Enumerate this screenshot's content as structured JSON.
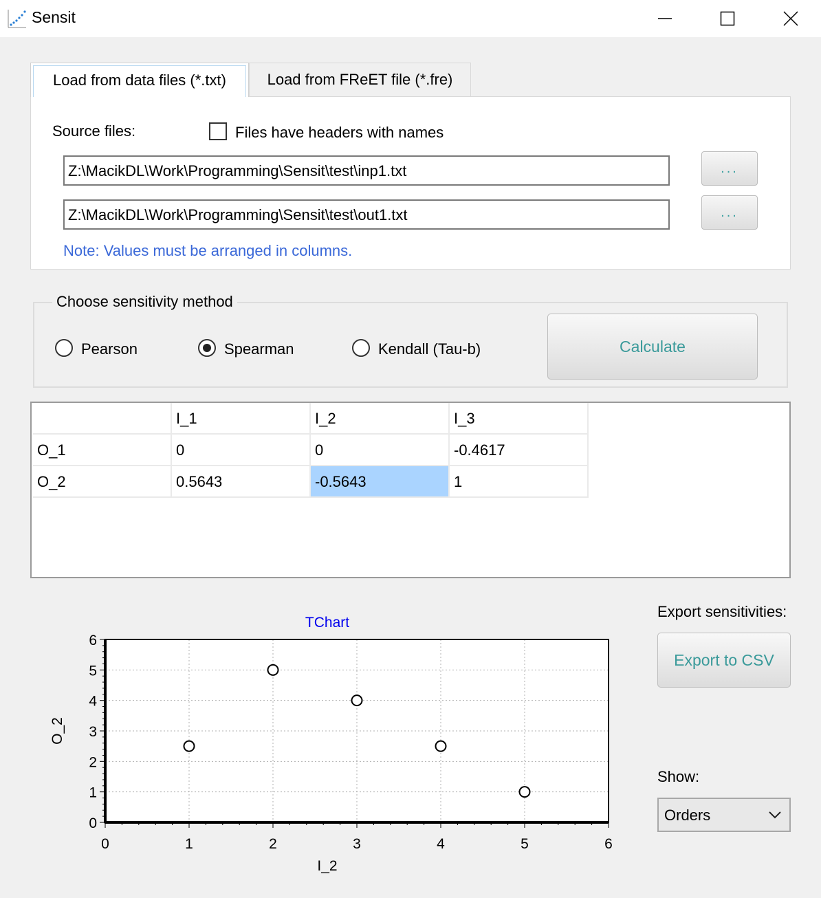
{
  "window": {
    "title": "Sensit"
  },
  "tabs": [
    {
      "label": "Load from data files (*.txt)",
      "active": true
    },
    {
      "label": "Load from FReET file (*.fre)",
      "active": false
    }
  ],
  "source": {
    "label": "Source files:",
    "headers_checkbox_label": "Files have headers with names",
    "headers_checked": false,
    "input_file": "Z:\\MacikDL\\Work\\Programming\\Sensit\\test\\inp1.txt",
    "output_file": "Z:\\MacikDL\\Work\\Programming\\Sensit\\test\\out1.txt",
    "browse_label": "...",
    "note": "Note: Values must be arranged in columns."
  },
  "method": {
    "group_title": "Choose sensitivity method",
    "options": [
      "Pearson",
      "Spearman",
      "Kendall (Tau-b)"
    ],
    "selected": "Spearman",
    "calculate_label": "Calculate"
  },
  "results": {
    "columns": [
      "",
      "I_1",
      "I_2",
      "I_3"
    ],
    "rows": [
      [
        "O_1",
        "0",
        "0",
        "-0.4617"
      ],
      [
        "O_2",
        "0.5643",
        "-0.5643",
        "1"
      ]
    ],
    "selected_cell": {
      "row": 1,
      "col": 2
    }
  },
  "export": {
    "label": "Export sensitivities:",
    "button_label": "Export to CSV"
  },
  "show": {
    "label": "Show:",
    "value": "Orders"
  },
  "chart_data": {
    "type": "scatter",
    "title": "TChart",
    "xlabel": "I_2",
    "ylabel": "O_2",
    "xlim": [
      0,
      6
    ],
    "ylim": [
      0,
      6
    ],
    "x_ticks": [
      "0",
      "1",
      "2",
      "3",
      "4",
      "5",
      "6"
    ],
    "y_ticks": [
      "0",
      "1",
      "2",
      "3",
      "4",
      "5",
      "6"
    ],
    "grid": true,
    "points": [
      {
        "x": 1,
        "y": 2.5
      },
      {
        "x": 2,
        "y": 5
      },
      {
        "x": 3,
        "y": 4
      },
      {
        "x": 4,
        "y": 2.5
      },
      {
        "x": 5,
        "y": 1
      }
    ],
    "colors": {
      "title": "#0000ee",
      "marker": "#000000"
    }
  }
}
